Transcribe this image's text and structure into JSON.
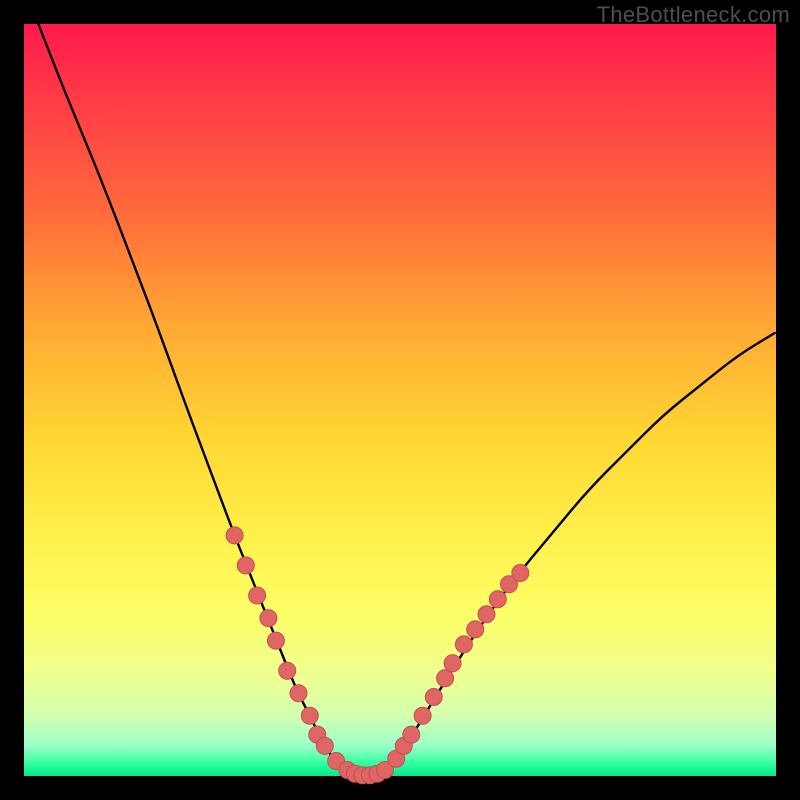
{
  "watermark": {
    "text": "TheBottleneck.com"
  },
  "colors": {
    "background": "#000000",
    "curve_stroke": "#000000",
    "marker_fill": "#e06666",
    "marker_stroke": "#c14f4f"
  },
  "chart_data": {
    "type": "line",
    "title": "",
    "xlabel": "",
    "ylabel": "",
    "xlim": [
      0,
      100
    ],
    "ylim": [
      0,
      100
    ],
    "grid": false,
    "background_gradient": [
      "#ff1a4d",
      "#ffd633",
      "#06e68a"
    ],
    "series": [
      {
        "name": "bottleneck_curve",
        "x": [
          0,
          5,
          10,
          15,
          18,
          22,
          25,
          28,
          30,
          32,
          34,
          36,
          38,
          40,
          42,
          44,
          46,
          48,
          50,
          52,
          55,
          60,
          65,
          70,
          75,
          80,
          85,
          90,
          95,
          100
        ],
        "values": [
          105,
          92,
          80,
          67,
          59,
          48,
          40,
          32,
          27,
          22,
          17,
          12,
          8,
          4,
          1,
          0,
          0,
          1,
          3,
          6,
          11,
          19,
          26,
          32,
          38,
          43,
          48,
          52,
          56,
          59
        ]
      }
    ],
    "markers": [
      {
        "x": 28,
        "y": 32
      },
      {
        "x": 29.5,
        "y": 28
      },
      {
        "x": 31,
        "y": 24
      },
      {
        "x": 32.5,
        "y": 21
      },
      {
        "x": 33.5,
        "y": 18
      },
      {
        "x": 35,
        "y": 14
      },
      {
        "x": 36.5,
        "y": 11
      },
      {
        "x": 38,
        "y": 8
      },
      {
        "x": 39,
        "y": 5.5
      },
      {
        "x": 40,
        "y": 4
      },
      {
        "x": 41.5,
        "y": 2
      },
      {
        "x": 43,
        "y": 0.8
      },
      {
        "x": 44,
        "y": 0.3
      },
      {
        "x": 45,
        "y": 0.1
      },
      {
        "x": 46,
        "y": 0.1
      },
      {
        "x": 47,
        "y": 0.3
      },
      {
        "x": 48,
        "y": 0.8
      },
      {
        "x": 49.5,
        "y": 2.3
      },
      {
        "x": 50.5,
        "y": 4
      },
      {
        "x": 51.5,
        "y": 5.5
      },
      {
        "x": 53,
        "y": 8
      },
      {
        "x": 54.5,
        "y": 10.5
      },
      {
        "x": 56,
        "y": 13
      },
      {
        "x": 57,
        "y": 15
      },
      {
        "x": 58.5,
        "y": 17.5
      },
      {
        "x": 60,
        "y": 19.5
      },
      {
        "x": 61.5,
        "y": 21.5
      },
      {
        "x": 63,
        "y": 23.5
      },
      {
        "x": 64.5,
        "y": 25.5
      },
      {
        "x": 66,
        "y": 27
      }
    ]
  }
}
